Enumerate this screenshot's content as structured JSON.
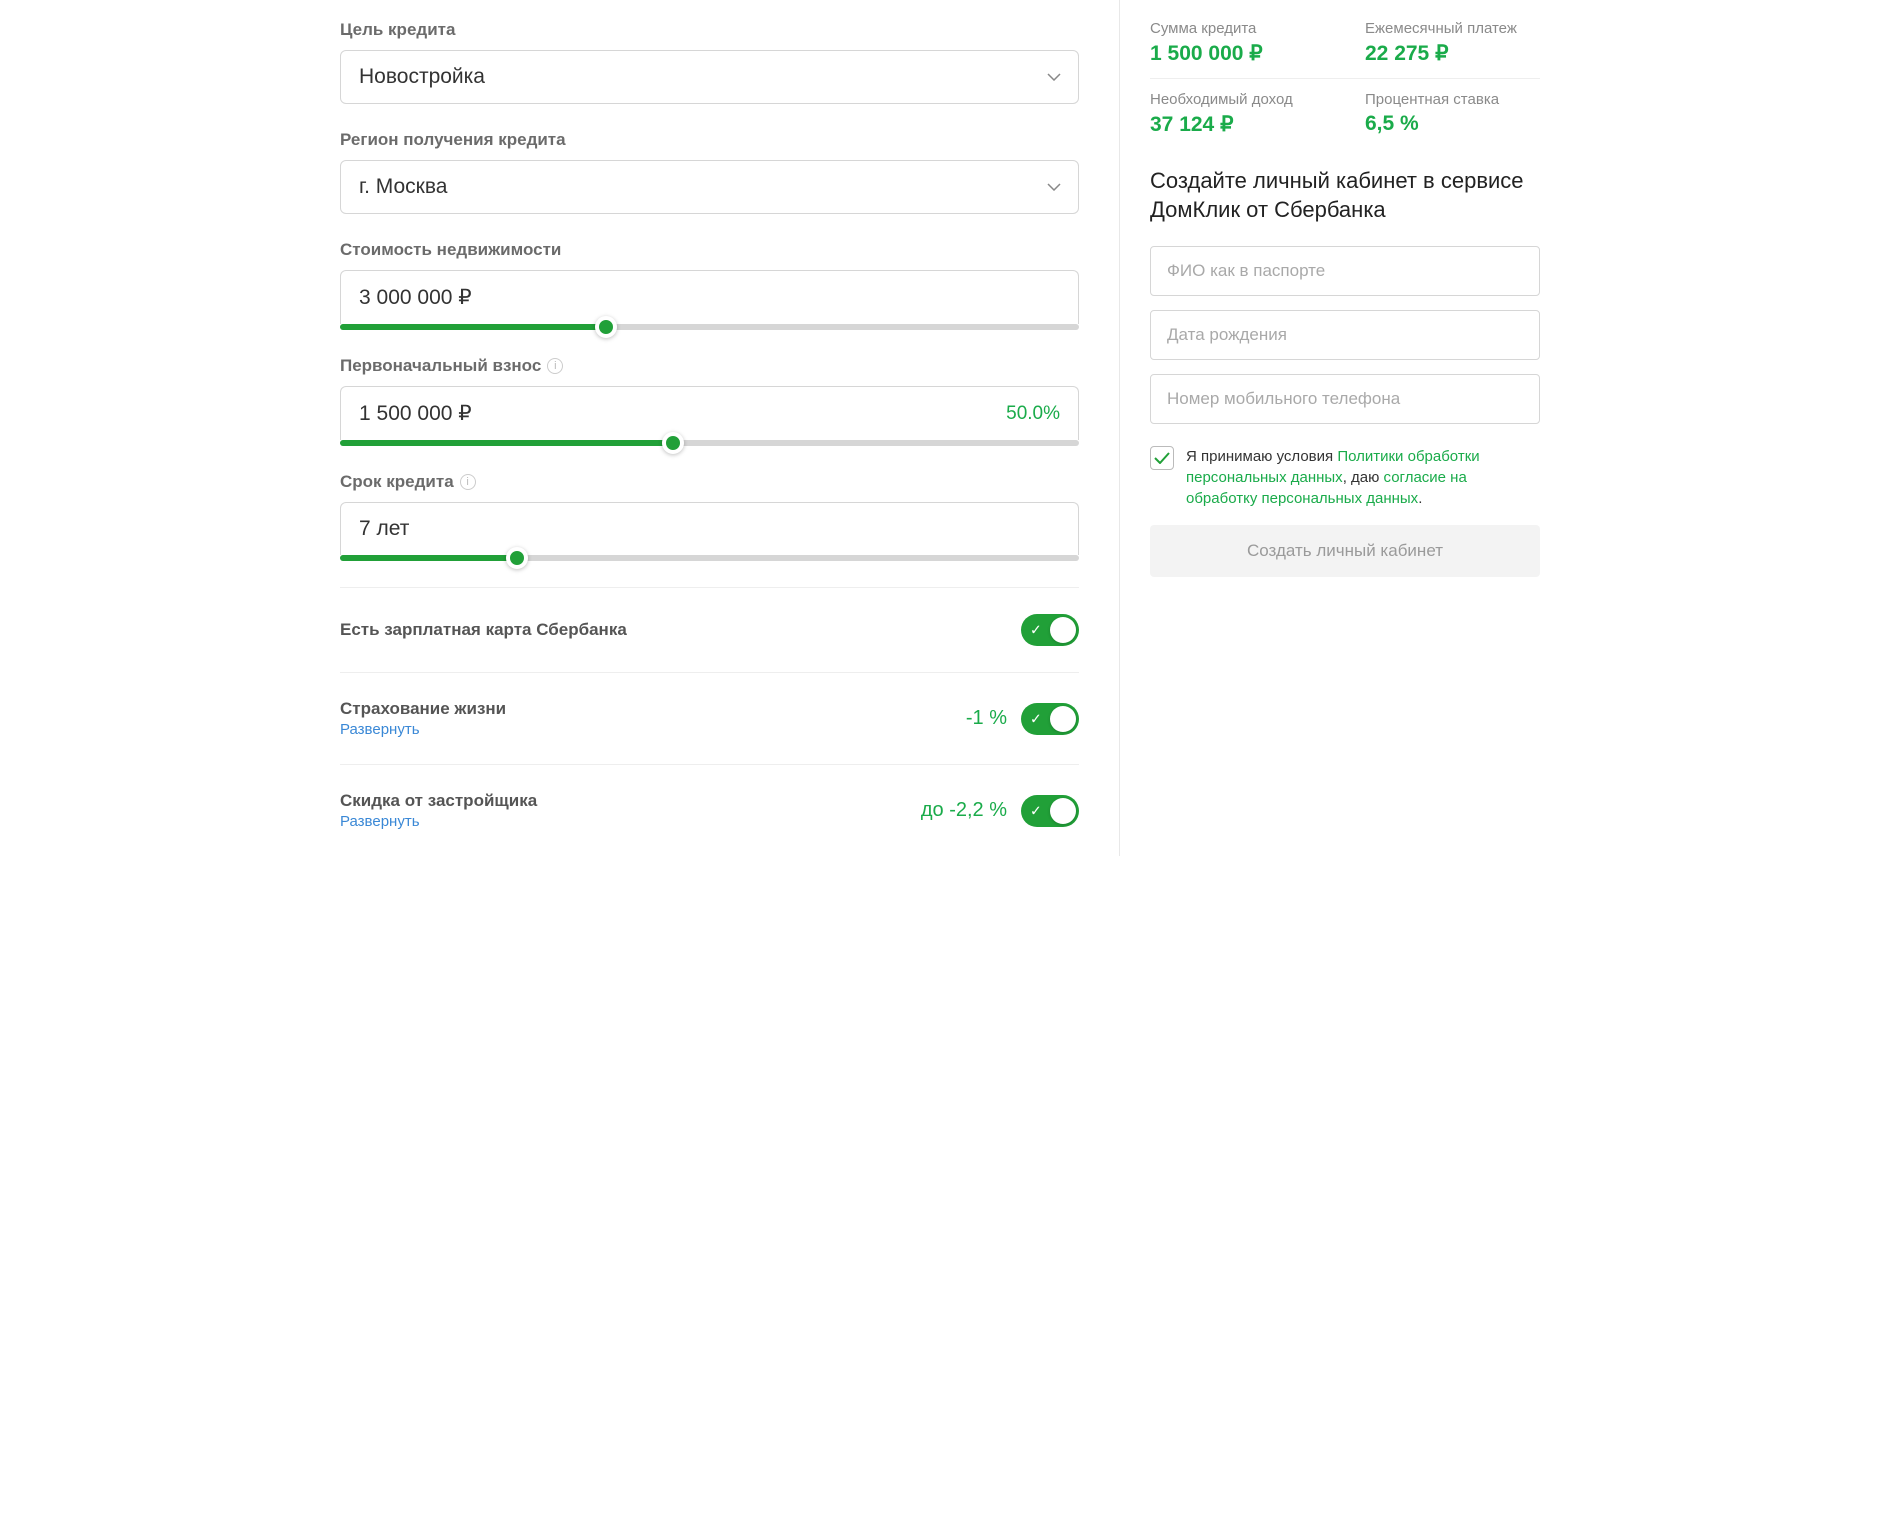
{
  "left": {
    "purpose": {
      "label": "Цель кредита",
      "value": "Новостройка"
    },
    "region": {
      "label": "Регион получения кредита",
      "value": "г. Москва"
    },
    "price": {
      "label": "Стоимость недвижимости",
      "value": "3 000 000 ₽",
      "slider_pct": 36
    },
    "downpay": {
      "label": "Первоначальный взнос",
      "value": "1 500 000 ₽",
      "suffix": "50.0%",
      "slider_pct": 45
    },
    "term": {
      "label": "Срок кредита",
      "value": "7 лет",
      "slider_pct": 24
    },
    "toggles": {
      "salary": {
        "label": "Есть зарплатная карта Сбербанка",
        "on": true
      },
      "life": {
        "label": "Страхование жизни",
        "discount": "-1 %",
        "expand": "Развернуть",
        "on": true
      },
      "builder": {
        "label": "Скидка от застройщика",
        "discount": "до -2,2 %",
        "expand": "Развернуть",
        "on": true
      }
    }
  },
  "right": {
    "summary": {
      "loan": {
        "label": "Сумма кредита",
        "value": "1 500 000 ₽"
      },
      "monthly": {
        "label": "Ежемесячный платеж",
        "value": "22 275 ₽"
      },
      "income": {
        "label": "Необходимый доход",
        "value": "37 124 ₽"
      },
      "rate": {
        "label": "Процентная ставка",
        "value": "6,5 %"
      }
    },
    "form": {
      "title": "Создайте личный кабинет в сервисе ДомКлик от Сбербанка",
      "fio_ph": "ФИО как в паспорте",
      "dob_ph": "Дата рождения",
      "phone_ph": "Номер мобильного телефона",
      "consent_1": "Я принимаю условия ",
      "consent_link1": "Политики обработки персональных данных",
      "consent_2": ", даю ",
      "consent_link2": "согласие на обработку персональных данных",
      "consent_3": ".",
      "button": "Создать личный кабинет"
    }
  }
}
